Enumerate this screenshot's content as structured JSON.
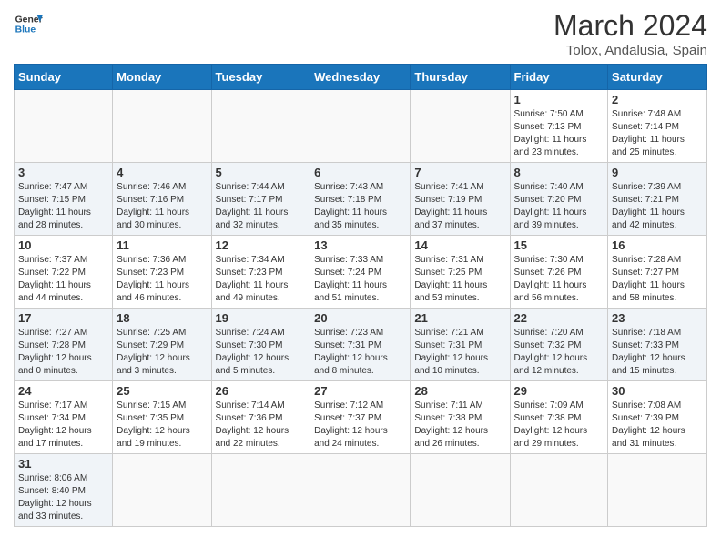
{
  "header": {
    "logo_general": "General",
    "logo_blue": "Blue",
    "month_year": "March 2024",
    "location": "Tolox, Andalusia, Spain"
  },
  "days_of_week": [
    "Sunday",
    "Monday",
    "Tuesday",
    "Wednesday",
    "Thursday",
    "Friday",
    "Saturday"
  ],
  "weeks": [
    [
      {
        "day": "",
        "info": ""
      },
      {
        "day": "",
        "info": ""
      },
      {
        "day": "",
        "info": ""
      },
      {
        "day": "",
        "info": ""
      },
      {
        "day": "",
        "info": ""
      },
      {
        "day": "1",
        "info": "Sunrise: 7:50 AM\nSunset: 7:13 PM\nDaylight: 11 hours\nand 23 minutes."
      },
      {
        "day": "2",
        "info": "Sunrise: 7:48 AM\nSunset: 7:14 PM\nDaylight: 11 hours\nand 25 minutes."
      }
    ],
    [
      {
        "day": "3",
        "info": "Sunrise: 7:47 AM\nSunset: 7:15 PM\nDaylight: 11 hours\nand 28 minutes."
      },
      {
        "day": "4",
        "info": "Sunrise: 7:46 AM\nSunset: 7:16 PM\nDaylight: 11 hours\nand 30 minutes."
      },
      {
        "day": "5",
        "info": "Sunrise: 7:44 AM\nSunset: 7:17 PM\nDaylight: 11 hours\nand 32 minutes."
      },
      {
        "day": "6",
        "info": "Sunrise: 7:43 AM\nSunset: 7:18 PM\nDaylight: 11 hours\nand 35 minutes."
      },
      {
        "day": "7",
        "info": "Sunrise: 7:41 AM\nSunset: 7:19 PM\nDaylight: 11 hours\nand 37 minutes."
      },
      {
        "day": "8",
        "info": "Sunrise: 7:40 AM\nSunset: 7:20 PM\nDaylight: 11 hours\nand 39 minutes."
      },
      {
        "day": "9",
        "info": "Sunrise: 7:39 AM\nSunset: 7:21 PM\nDaylight: 11 hours\nand 42 minutes."
      }
    ],
    [
      {
        "day": "10",
        "info": "Sunrise: 7:37 AM\nSunset: 7:22 PM\nDaylight: 11 hours\nand 44 minutes."
      },
      {
        "day": "11",
        "info": "Sunrise: 7:36 AM\nSunset: 7:23 PM\nDaylight: 11 hours\nand 46 minutes."
      },
      {
        "day": "12",
        "info": "Sunrise: 7:34 AM\nSunset: 7:23 PM\nDaylight: 11 hours\nand 49 minutes."
      },
      {
        "day": "13",
        "info": "Sunrise: 7:33 AM\nSunset: 7:24 PM\nDaylight: 11 hours\nand 51 minutes."
      },
      {
        "day": "14",
        "info": "Sunrise: 7:31 AM\nSunset: 7:25 PM\nDaylight: 11 hours\nand 53 minutes."
      },
      {
        "day": "15",
        "info": "Sunrise: 7:30 AM\nSunset: 7:26 PM\nDaylight: 11 hours\nand 56 minutes."
      },
      {
        "day": "16",
        "info": "Sunrise: 7:28 AM\nSunset: 7:27 PM\nDaylight: 11 hours\nand 58 minutes."
      }
    ],
    [
      {
        "day": "17",
        "info": "Sunrise: 7:27 AM\nSunset: 7:28 PM\nDaylight: 12 hours\nand 0 minutes."
      },
      {
        "day": "18",
        "info": "Sunrise: 7:25 AM\nSunset: 7:29 PM\nDaylight: 12 hours\nand 3 minutes."
      },
      {
        "day": "19",
        "info": "Sunrise: 7:24 AM\nSunset: 7:30 PM\nDaylight: 12 hours\nand 5 minutes."
      },
      {
        "day": "20",
        "info": "Sunrise: 7:23 AM\nSunset: 7:31 PM\nDaylight: 12 hours\nand 8 minutes."
      },
      {
        "day": "21",
        "info": "Sunrise: 7:21 AM\nSunset: 7:31 PM\nDaylight: 12 hours\nand 10 minutes."
      },
      {
        "day": "22",
        "info": "Sunrise: 7:20 AM\nSunset: 7:32 PM\nDaylight: 12 hours\nand 12 minutes."
      },
      {
        "day": "23",
        "info": "Sunrise: 7:18 AM\nSunset: 7:33 PM\nDaylight: 12 hours\nand 15 minutes."
      }
    ],
    [
      {
        "day": "24",
        "info": "Sunrise: 7:17 AM\nSunset: 7:34 PM\nDaylight: 12 hours\nand 17 minutes."
      },
      {
        "day": "25",
        "info": "Sunrise: 7:15 AM\nSunset: 7:35 PM\nDaylight: 12 hours\nand 19 minutes."
      },
      {
        "day": "26",
        "info": "Sunrise: 7:14 AM\nSunset: 7:36 PM\nDaylight: 12 hours\nand 22 minutes."
      },
      {
        "day": "27",
        "info": "Sunrise: 7:12 AM\nSunset: 7:37 PM\nDaylight: 12 hours\nand 24 minutes."
      },
      {
        "day": "28",
        "info": "Sunrise: 7:11 AM\nSunset: 7:38 PM\nDaylight: 12 hours\nand 26 minutes."
      },
      {
        "day": "29",
        "info": "Sunrise: 7:09 AM\nSunset: 7:38 PM\nDaylight: 12 hours\nand 29 minutes."
      },
      {
        "day": "30",
        "info": "Sunrise: 7:08 AM\nSunset: 7:39 PM\nDaylight: 12 hours\nand 31 minutes."
      }
    ],
    [
      {
        "day": "31",
        "info": "Sunrise: 8:06 AM\nSunset: 8:40 PM\nDaylight: 12 hours\nand 33 minutes."
      },
      {
        "day": "",
        "info": ""
      },
      {
        "day": "",
        "info": ""
      },
      {
        "day": "",
        "info": ""
      },
      {
        "day": "",
        "info": ""
      },
      {
        "day": "",
        "info": ""
      },
      {
        "day": "",
        "info": ""
      }
    ]
  ]
}
